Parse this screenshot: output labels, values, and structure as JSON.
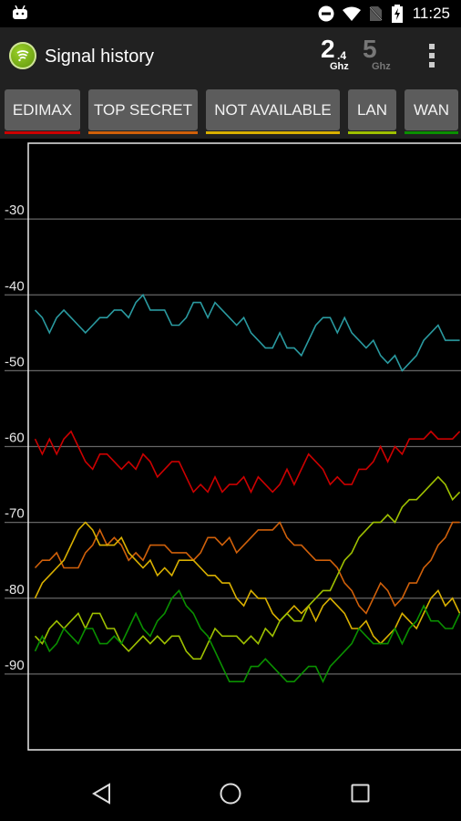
{
  "status_bar": {
    "time": "11:25",
    "icons": [
      "android-debug-icon",
      "do-not-disturb-icon",
      "wifi-icon",
      "no-sim-icon",
      "battery-charging-icon"
    ]
  },
  "app_bar": {
    "title": "Signal history",
    "band_24": {
      "main": "2",
      "sub": ".4",
      "unit": "Ghz",
      "active": true
    },
    "band_5": {
      "main": "5",
      "unit": "Ghz",
      "active": false
    },
    "menu_icon": "overflow-menu-icon"
  },
  "networks": [
    {
      "label": "EDIMAX",
      "color": "#cc0000"
    },
    {
      "label": "TOP SECRET",
      "color": "#d0600a"
    },
    {
      "label": "NOT AVAILABLE",
      "color": "#d9b000"
    },
    {
      "label": "LAN",
      "color": "#9ec000"
    },
    {
      "label": "WAN",
      "color": "#0a9000"
    }
  ],
  "chart_data": {
    "type": "line",
    "title": "",
    "xlabel": "",
    "ylabel": "",
    "ylim": [
      -100,
      -20
    ],
    "yticks": [
      -30,
      -40,
      -50,
      -60,
      -70,
      -80,
      -90
    ],
    "grid": true,
    "legend": "top (buttons)",
    "x": "sample index 0-59",
    "series": [
      {
        "name": "EDIMAX",
        "color": "#cc0000",
        "values": [
          -59,
          -61,
          -59,
          -61,
          -59,
          -58,
          -60,
          -62,
          -63,
          -61,
          -61,
          -62,
          -63,
          -62,
          -63,
          -61,
          -62,
          -64,
          -63,
          -62,
          -62,
          -64,
          -66,
          -65,
          -66,
          -64,
          -66,
          -65,
          -65,
          -64,
          -66,
          -64,
          -65,
          -66,
          -65,
          -63,
          -65,
          -63,
          -61,
          -62,
          -63,
          -65,
          -64,
          -65,
          -65,
          -63,
          -63,
          -62,
          -60,
          -62,
          -60,
          -61,
          -59,
          -59,
          -59,
          -58,
          -59,
          -59,
          -59,
          -58
        ]
      },
      {
        "name": "TOP SECRET",
        "color": "#d0600a",
        "values": [
          -76,
          -75,
          -75,
          -74,
          -76,
          -76,
          -76,
          -74,
          -73,
          -71,
          -73,
          -72,
          -73,
          -75,
          -74,
          -75,
          -73,
          -73,
          -73,
          -74,
          -74,
          -74,
          -75,
          -74,
          -72,
          -72,
          -73,
          -72,
          -74,
          -73,
          -72,
          -71,
          -71,
          -71,
          -70,
          -72,
          -73,
          -73,
          -74,
          -75,
          -75,
          -75,
          -76,
          -78,
          -79,
          -81,
          -82,
          -80,
          -78,
          -79,
          -81,
          -80,
          -78,
          -78,
          -76,
          -75,
          -73,
          -72,
          -70,
          -70
        ]
      },
      {
        "name": "NOT AVAILABLE",
        "color": "#d9b000",
        "values": [
          -80,
          -78,
          -77,
          -76,
          -75,
          -73,
          -71,
          -70,
          -71,
          -73,
          -73,
          -73,
          -72,
          -74,
          -75,
          -76,
          -75,
          -77,
          -76,
          -77,
          -75,
          -75,
          -75,
          -76,
          -77,
          -77,
          -78,
          -78,
          -80,
          -81,
          -79,
          -80,
          -80,
          -82,
          -83,
          -82,
          -81,
          -82,
          -81,
          -83,
          -81,
          -80,
          -81,
          -82,
          -84,
          -84,
          -83,
          -85,
          -86,
          -85,
          -84,
          -82,
          -83,
          -84,
          -82,
          -80,
          -79,
          -81,
          -80,
          -82
        ]
      },
      {
        "name": "LAN",
        "color": "#9ec000",
        "values": [
          -85,
          -86,
          -84,
          -83,
          -84,
          -83,
          -82,
          -84,
          -82,
          -82,
          -84,
          -84,
          -86,
          -87,
          -86,
          -85,
          -86,
          -85,
          -86,
          -85,
          -85,
          -87,
          -88,
          -88,
          -86,
          -84,
          -85,
          -85,
          -85,
          -86,
          -85,
          -86,
          -84,
          -85,
          -83,
          -82,
          -83,
          -83,
          -81,
          -80,
          -79,
          -79,
          -77,
          -75,
          -74,
          -72,
          -71,
          -70,
          -70,
          -69,
          -70,
          -68,
          -67,
          -67,
          -66,
          -65,
          -64,
          -65,
          -67,
          -66
        ]
      },
      {
        "name": "WAN",
        "color": "#0a9000",
        "values": [
          -87,
          -85,
          -87,
          -86,
          -84,
          -85,
          -86,
          -84,
          -84,
          -86,
          -86,
          -85,
          -86,
          -84,
          -82,
          -84,
          -85,
          -83,
          -82,
          -80,
          -79,
          -81,
          -82,
          -84,
          -85,
          -87,
          -89,
          -91,
          -91,
          -91,
          -89,
          -89,
          -88,
          -89,
          -90,
          -91,
          -91,
          -90,
          -89,
          -89,
          -91,
          -89,
          -88,
          -87,
          -86,
          -84,
          -85,
          -86,
          -86,
          -86,
          -84,
          -86,
          -84,
          -83,
          -81,
          -83,
          -83,
          -84,
          -84,
          -82
        ]
      },
      {
        "name": "unlabeled-cyan",
        "color": "#2a9aa0",
        "values": [
          -42,
          -43,
          -45,
          -43,
          -42,
          -43,
          -44,
          -45,
          -44,
          -43,
          -43,
          -42,
          -42,
          -43,
          -41,
          -40,
          -42,
          -42,
          -42,
          -44,
          -44,
          -43,
          -41,
          -41,
          -43,
          -41,
          -42,
          -43,
          -44,
          -43,
          -45,
          -46,
          -47,
          -47,
          -45,
          -47,
          -47,
          -48,
          -46,
          -44,
          -43,
          -43,
          -45,
          -43,
          -45,
          -46,
          -47,
          -46,
          -48,
          -49,
          -48,
          -50,
          -49,
          -48,
          -46,
          -45,
          -44,
          -46,
          -46,
          -46
        ]
      }
    ]
  },
  "nav_bar": {
    "back": "back-icon",
    "home": "home-icon",
    "recents": "recents-icon"
  }
}
